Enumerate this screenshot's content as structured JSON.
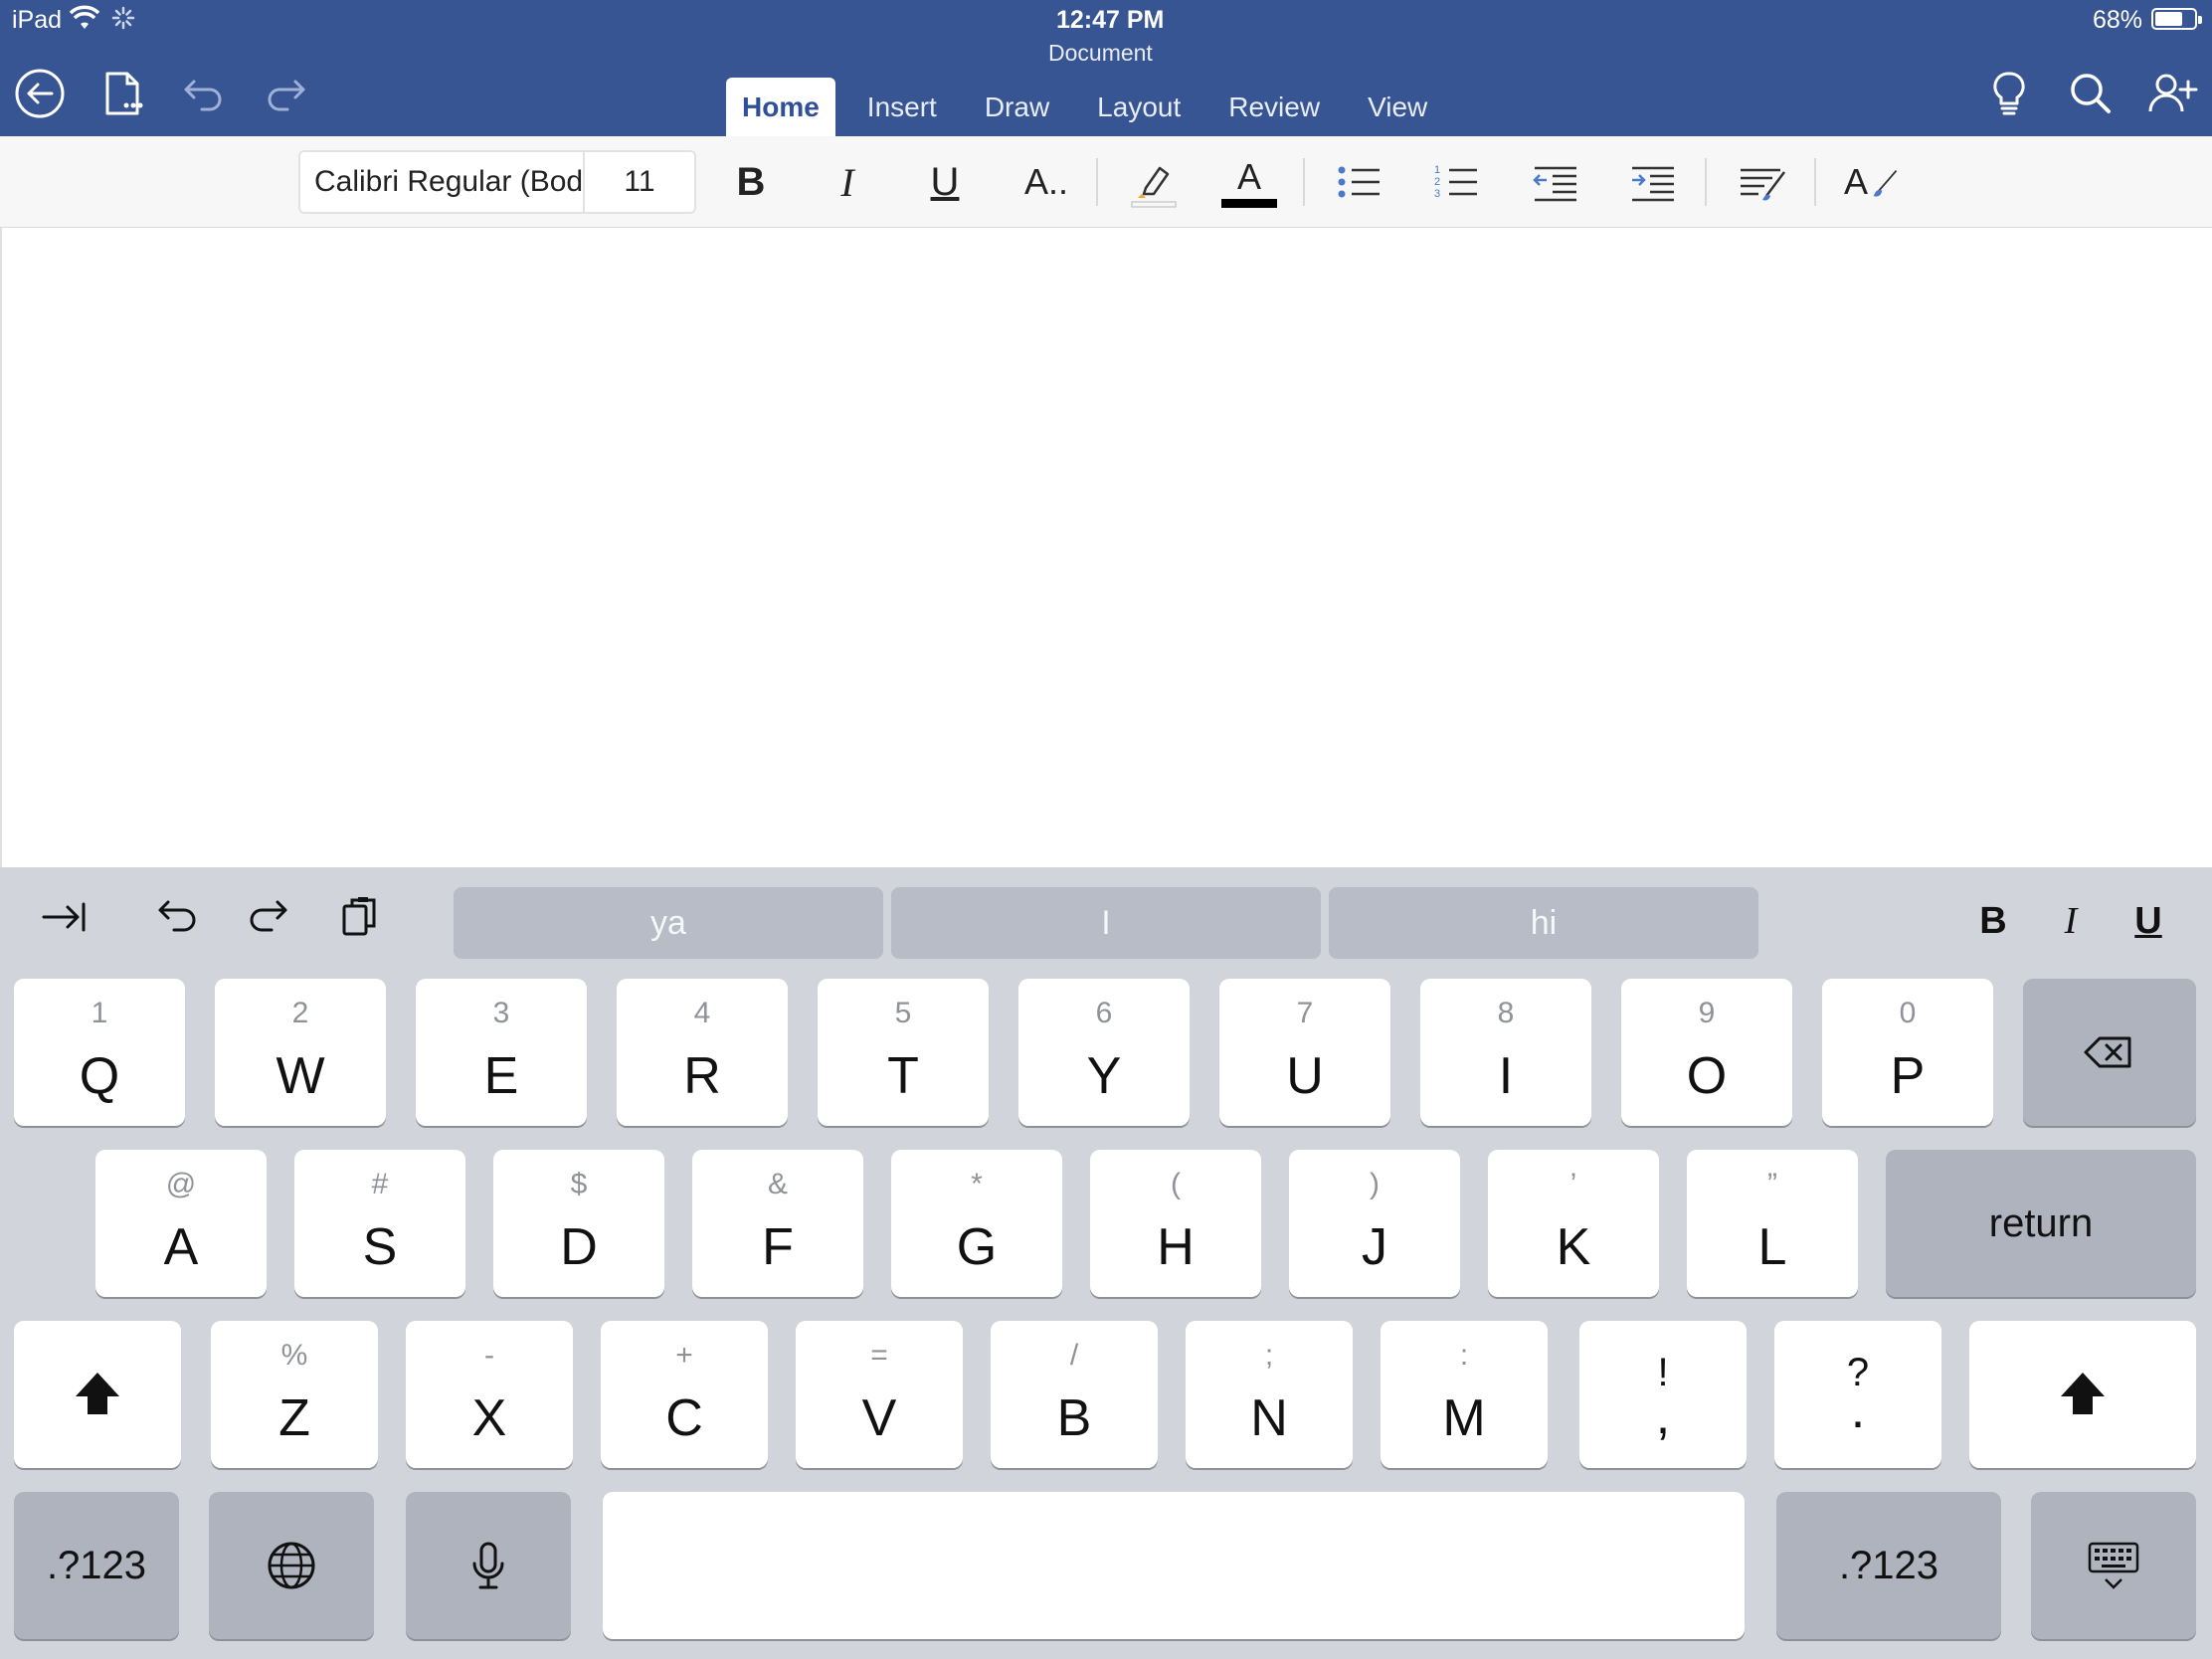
{
  "status_bar": {
    "device": "iPad",
    "time": "12:47 PM",
    "battery": "68%"
  },
  "document": {
    "title": "Document"
  },
  "tabs": [
    "Home",
    "Insert",
    "Draw",
    "Layout",
    "Review",
    "View"
  ],
  "active_tab": "Home",
  "header_icons": [
    "back-icon",
    "file-icon",
    "undo-icon",
    "redo-icon",
    "lightbulb-icon",
    "search-icon",
    "share-user-icon"
  ],
  "ribbon": {
    "font_name": "Calibri Regular (Body)",
    "font_size": "11",
    "bold": "B",
    "italic": "I",
    "underline": "U",
    "more_formatting": "A..",
    "font_color": "A",
    "font_color_value": "#000000",
    "styles": "A"
  },
  "keyboard_toolbar": {
    "suggestions": [
      "ya",
      "I",
      "hi"
    ],
    "bold": "B",
    "italic": "I",
    "underline": "U"
  },
  "keyboard": {
    "row1": [
      {
        "sub": "1",
        "main": "Q"
      },
      {
        "sub": "2",
        "main": "W"
      },
      {
        "sub": "3",
        "main": "E"
      },
      {
        "sub": "4",
        "main": "R"
      },
      {
        "sub": "5",
        "main": "T"
      },
      {
        "sub": "6",
        "main": "Y"
      },
      {
        "sub": "7",
        "main": "U"
      },
      {
        "sub": "8",
        "main": "I"
      },
      {
        "sub": "9",
        "main": "O"
      },
      {
        "sub": "0",
        "main": "P"
      }
    ],
    "row2": [
      {
        "sub": "@",
        "main": "A"
      },
      {
        "sub": "#",
        "main": "S"
      },
      {
        "sub": "$",
        "main": "D"
      },
      {
        "sub": "&",
        "main": "F"
      },
      {
        "sub": "*",
        "main": "G"
      },
      {
        "sub": "(",
        "main": "H"
      },
      {
        "sub": ")",
        "main": "J"
      },
      {
        "sub": "’",
        "main": "K"
      },
      {
        "sub": "”",
        "main": "L"
      }
    ],
    "row3": [
      {
        "sub": "%",
        "main": "Z"
      },
      {
        "sub": "-",
        "main": "X"
      },
      {
        "sub": "+",
        "main": "C"
      },
      {
        "sub": "=",
        "main": "V"
      },
      {
        "sub": "/",
        "main": "B"
      },
      {
        "sub": ";",
        "main": "N"
      },
      {
        "sub": ":",
        "main": "M"
      },
      {
        "sub": "!",
        "main": ","
      },
      {
        "sub": "?",
        "main": "."
      }
    ],
    "return_label": "return",
    "numbers_label": ".?123"
  }
}
